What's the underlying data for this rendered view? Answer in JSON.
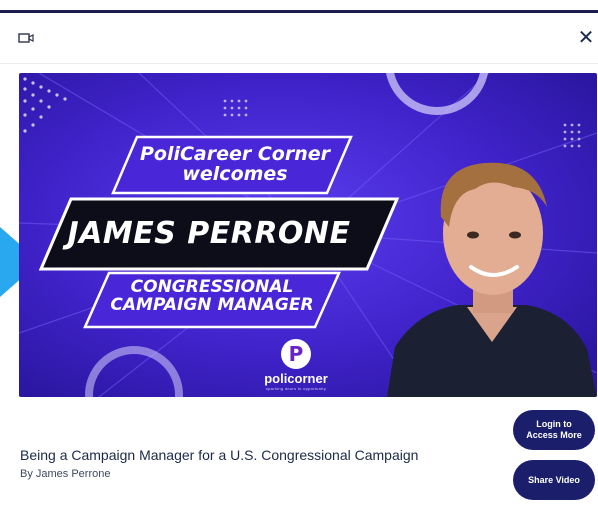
{
  "modal": {
    "header": {
      "icon": "video-camera-icon",
      "close_icon": "close-icon",
      "close_label": "✕"
    }
  },
  "thumbnail": {
    "banner_top": "PoliCareer Corner welcomes",
    "banner_name": "JAMES PERRONE",
    "banner_role": "CONGRESSIONAL CAMPAIGN MANAGER",
    "brand_mark": "P",
    "brand_name": "policorner",
    "brand_tagline": "sparking doors to opportunity",
    "colors": {
      "background": "#4a26d9",
      "banner_dark": "#0d0d1a",
      "accent": "#6a22c9"
    }
  },
  "video": {
    "title": "Being a Campaign Manager for a U.S. Congressional Campaign",
    "author": "By James Perrone"
  },
  "actions": {
    "login_label": "Login to Access More",
    "share_label": "Share Video",
    "button_color": "#1b1f6b"
  }
}
